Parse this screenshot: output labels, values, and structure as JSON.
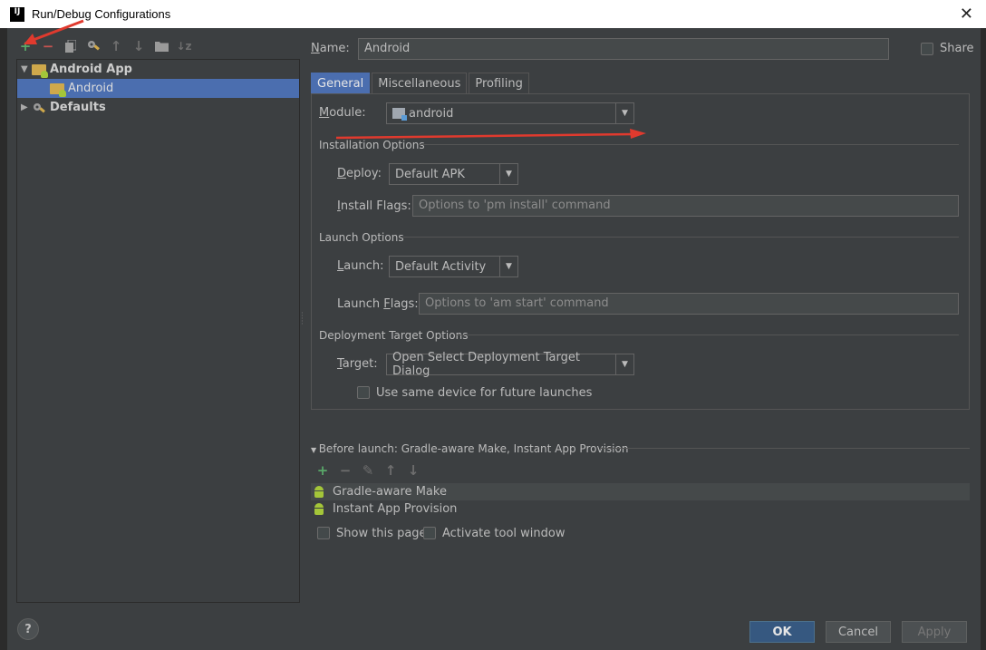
{
  "window": {
    "title": "Run/Debug Configurations",
    "app_icon_text": "IJ"
  },
  "toolbar": {
    "icons": [
      "add-icon",
      "remove-icon",
      "copy-icon",
      "edit-defaults-icon",
      "move-up-icon",
      "move-down-icon",
      "folder-icon",
      "sort-icon"
    ]
  },
  "tree": {
    "items": [
      {
        "label": "Android App",
        "expanded": true
      },
      {
        "label": "Android",
        "selected": true
      },
      {
        "label": "Defaults",
        "expanded": false
      }
    ]
  },
  "name": {
    "label": "Name:",
    "value": "Android"
  },
  "share": {
    "label": "Share",
    "checked": false
  },
  "tabs": [
    {
      "label": "General",
      "active": true
    },
    {
      "label": "Miscellaneous"
    },
    {
      "label": "Profiling"
    }
  ],
  "module": {
    "label": "Module:",
    "value": "android"
  },
  "installation": {
    "title": "Installation Options",
    "deploy_label": "Deploy:",
    "deploy_value": "Default APK",
    "flags_label": "Install Flags:",
    "flags_placeholder": "Options to 'pm install' command"
  },
  "launch": {
    "title": "Launch Options",
    "launch_label": "Launch:",
    "launch_value": "Default Activity",
    "flags_label": "Launch Flags:",
    "flags_placeholder": "Options to 'am start' command"
  },
  "deployment": {
    "title": "Deployment Target Options",
    "target_label": "Target:",
    "target_value": "Open Select Deployment Target Dialog",
    "same_device_label": "Use same device for future launches",
    "same_device_checked": false
  },
  "before_launch": {
    "title": "Before launch: Gradle-aware Make, Instant App Provision",
    "items": [
      "Gradle-aware Make",
      "Instant App Provision"
    ]
  },
  "options": {
    "show_page_label": "Show this page",
    "activate_tool_label": "Activate tool window"
  },
  "buttons": {
    "ok": "OK",
    "cancel": "Cancel",
    "apply": "Apply",
    "help": "?"
  },
  "colors": {
    "accent": "#4b6eaf",
    "annotation": "#e03a2e",
    "add": "#59a869",
    "remove": "#c75450"
  }
}
